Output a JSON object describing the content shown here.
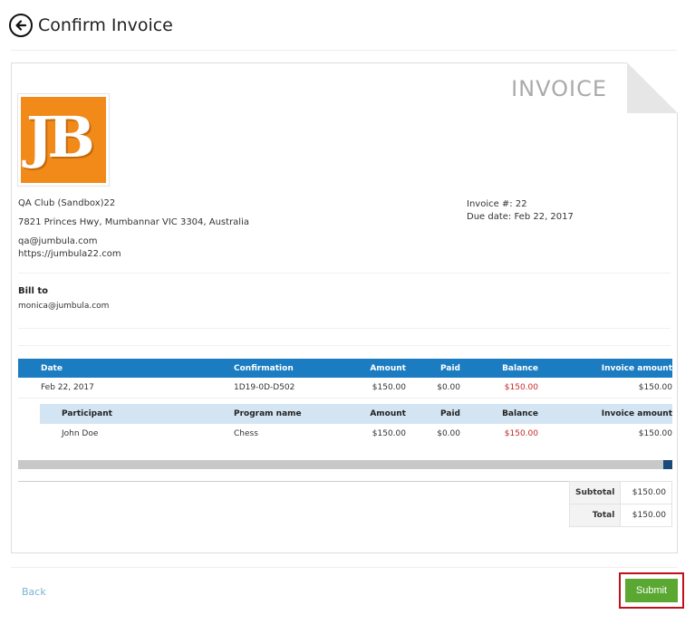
{
  "header": {
    "title": "Confirm Invoice"
  },
  "invoice": {
    "label": "INVOICE",
    "logo_text": "JB",
    "company": {
      "name": "QA Club (Sandbox)22",
      "address": "7821 Princes Hwy, Mumbannar VIC 3304, Australia",
      "email": "qa@jumbula.com",
      "website": "https://jumbula22.com"
    },
    "number_text": "Invoice #: 22",
    "due_text": "Due date: Feb 22, 2017",
    "bill_to_label": "Bill to",
    "bill_to_email": "monica@jumbula.com",
    "main_headers": [
      "Date",
      "Confirmation",
      "Amount",
      "Paid",
      "Balance",
      "Invoice amount"
    ],
    "main_row": [
      "Feb 22, 2017",
      "1D19-0D-D502",
      "$150.00",
      "$0.00",
      "$150.00",
      "$150.00"
    ],
    "sub_headers": [
      "Participant",
      "Program name",
      "Amount",
      "Paid",
      "Balance",
      "Invoice amount"
    ],
    "sub_row": [
      "John Doe",
      "Chess",
      "$150.00",
      "$0.00",
      "$150.00",
      "$150.00"
    ],
    "subtotal_label": "Subtotal",
    "subtotal_value": "$150.00",
    "total_label": "Total",
    "total_value": "$150.00"
  },
  "footer": {
    "back_label": "Back",
    "submit_label": "Submit"
  },
  "colors": {
    "table_header": "#1b7cc1",
    "sub_header": "#d3e5f3",
    "balance": "#c62828",
    "submit": "#5aa832",
    "highlight": "#c0101a",
    "logo": "#f28a1a"
  }
}
